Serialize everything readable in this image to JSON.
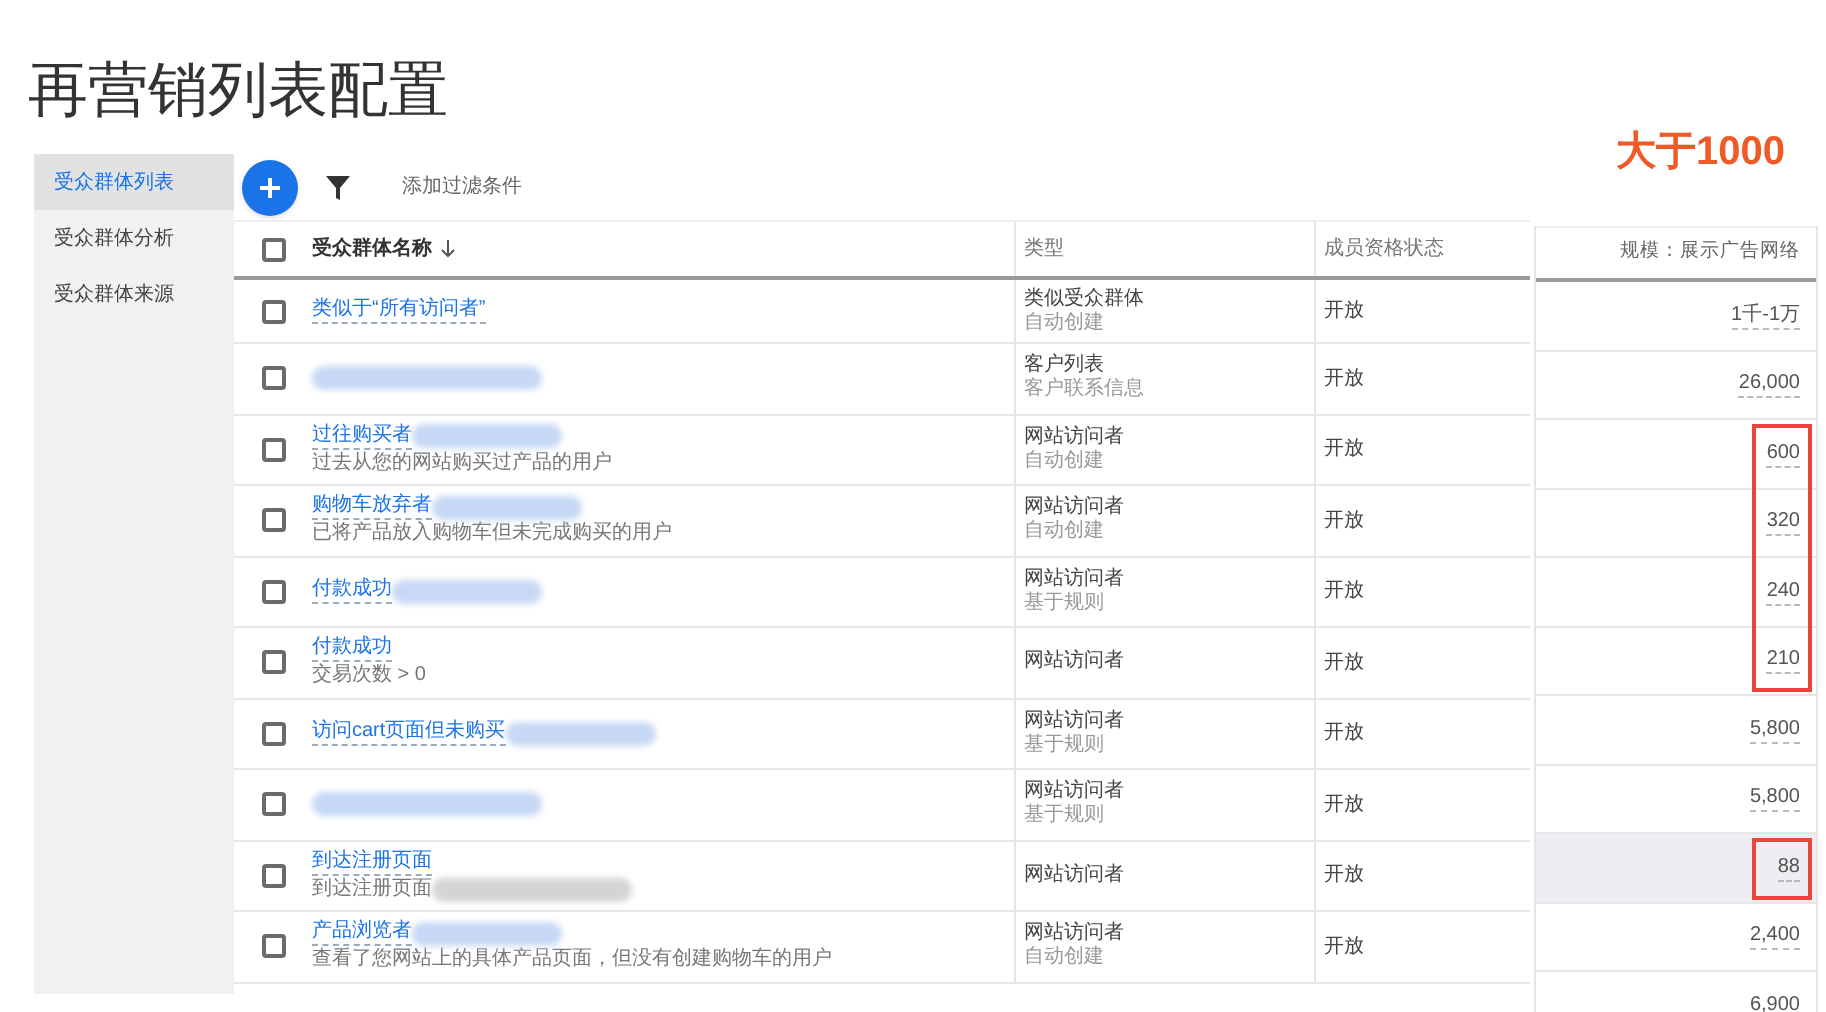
{
  "title": "再营销列表配置",
  "annotation": {
    "text": "大于1000",
    "color": "#f05a28"
  },
  "sidebar": {
    "items": [
      {
        "label": "受众群体列表",
        "selected": true
      },
      {
        "label": "受众群体分析",
        "selected": false
      },
      {
        "label": "受众群体来源",
        "selected": false
      }
    ]
  },
  "toolbar": {
    "filter_placeholder": "添加过滤条件"
  },
  "table": {
    "header_checked": false,
    "columns": [
      {
        "label": "受众群体名称",
        "sorted": true
      },
      {
        "label": "类型",
        "sorted": false
      },
      {
        "label": "成员资格状态",
        "sorted": false
      }
    ],
    "rows": [
      {
        "checked": false,
        "name": "类似于“所有访问者”",
        "name_redacted": false,
        "type": "类似受众群体",
        "type_detail": "自动创建",
        "status": "开放"
      },
      {
        "checked": false,
        "name_redacted": true,
        "type": "客户列表",
        "type_detail": "客户联系信息",
        "status": "开放"
      },
      {
        "checked": false,
        "name": "过往购买者",
        "name_redacted": true,
        "description": "过去从您的网站购买过产品的用户",
        "type": "网站访问者",
        "type_detail": "自动创建",
        "status": "开放"
      },
      {
        "checked": false,
        "name": "购物车放弃者",
        "name_redacted": true,
        "description": "已将产品放入购物车但未完成购买的用户",
        "type": "网站访问者",
        "type_detail": "自动创建",
        "status": "开放"
      },
      {
        "checked": false,
        "name": "付款成功",
        "name_redacted": true,
        "type": "网站访问者",
        "type_detail": "基于规则",
        "status": "开放"
      },
      {
        "checked": false,
        "name": "付款成功",
        "name_redacted": false,
        "description": "交易次数 > 0",
        "type": "网站访问者",
        "status": "开放"
      },
      {
        "checked": false,
        "name": "访问cart页面但未购买",
        "name_redacted": true,
        "type": "网站访问者",
        "type_detail": "基于规则",
        "status": "开放"
      },
      {
        "checked": false,
        "name_redacted": true,
        "type": "网站访问者",
        "type_detail": "基于规则",
        "status": "开放"
      },
      {
        "checked": false,
        "name": "到达注册页面",
        "name_redacted": false,
        "description": "到达注册页面",
        "description_redacted": true,
        "type": "网站访问者",
        "status": "开放"
      },
      {
        "checked": false,
        "name": "产品浏览者",
        "name_redacted": true,
        "description": "查看了您网站上的具体产品页面，但没有创建购物车的用户",
        "type": "网站访问者",
        "type_detail": "自动创建",
        "status": "开放"
      }
    ]
  },
  "size_panel": {
    "header": "规模：展示广告网络",
    "cells": [
      {
        "value": "1千-1万",
        "boxed": false,
        "selected": false
      },
      {
        "value": "26,000",
        "boxed": false,
        "selected": false
      },
      {
        "value": "600",
        "boxed": true,
        "selected": false
      },
      {
        "value": "320",
        "boxed": true,
        "selected": false
      },
      {
        "value": "240",
        "boxed": true,
        "selected": false
      },
      {
        "value": "210",
        "boxed": true,
        "selected": false
      },
      {
        "value": "5,800",
        "boxed": false,
        "selected": false
      },
      {
        "value": "5,800",
        "boxed": false,
        "selected": false
      },
      {
        "value": "88",
        "boxed": true,
        "selected": true
      },
      {
        "value": "2,400",
        "boxed": false,
        "selected": false
      },
      {
        "value": "6,900",
        "boxed": false,
        "selected": false
      }
    ]
  }
}
